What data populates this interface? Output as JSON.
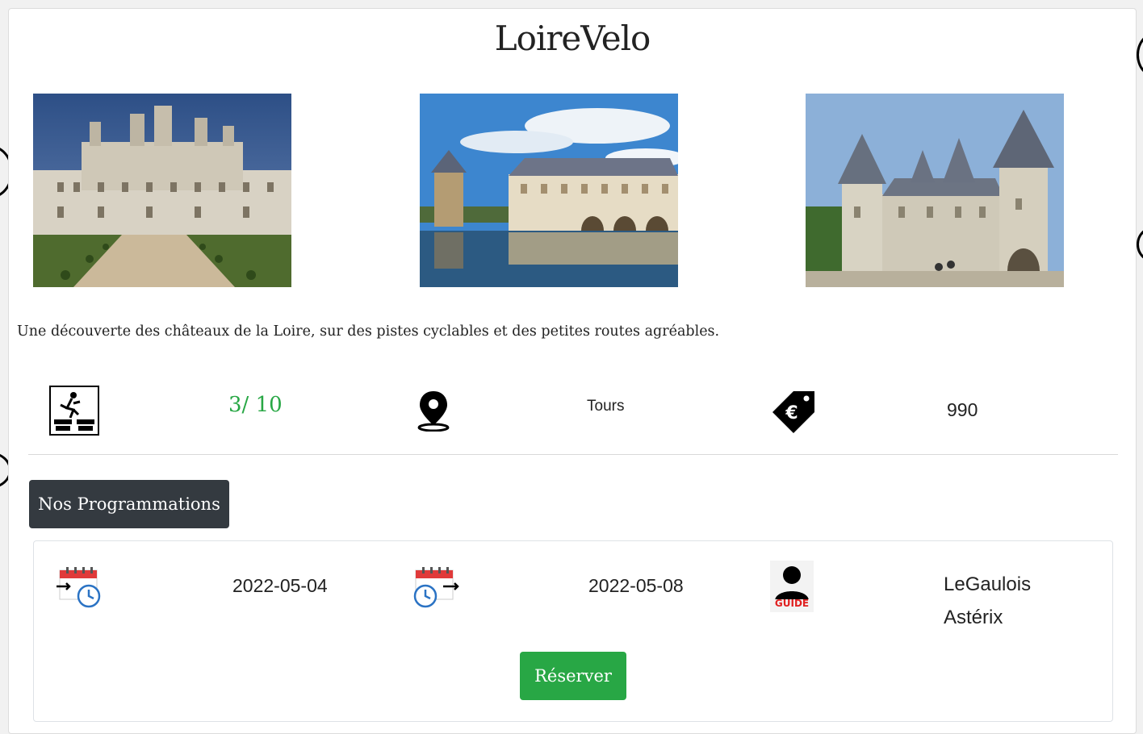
{
  "app": {
    "title": "LoireVelo"
  },
  "photos": [
    {
      "name": "chateau-chambord"
    },
    {
      "name": "chateau-chenonceau"
    },
    {
      "name": "chateau-chaumont"
    }
  ],
  "description": "Une découverte des châteaux de la Loire, sur des pistes cyclables et des petites routes agréables.",
  "info": {
    "difficulty_icon": "difficulty-icon",
    "difficulty": "3/ 10",
    "location_icon": "map-pin-icon",
    "location": "Tours",
    "price_icon": "euro-tag-icon",
    "price": "990"
  },
  "programs": {
    "button_label": "Nos Programmations",
    "items": [
      {
        "start_icon": "calendar-start-icon",
        "start_date": "2022-05-04",
        "end_icon": "calendar-end-icon",
        "end_date": "2022-05-08",
        "guide_icon": "guide-icon",
        "guide_badge": "GUIDE",
        "guide_lastname": "LeGaulois",
        "guide_firstname": "Astérix",
        "reserve_label": "Réserver"
      }
    ]
  },
  "colors": {
    "accent_green": "#28a745",
    "dark_button": "#343a40",
    "difficulty_text": "#28a745"
  }
}
